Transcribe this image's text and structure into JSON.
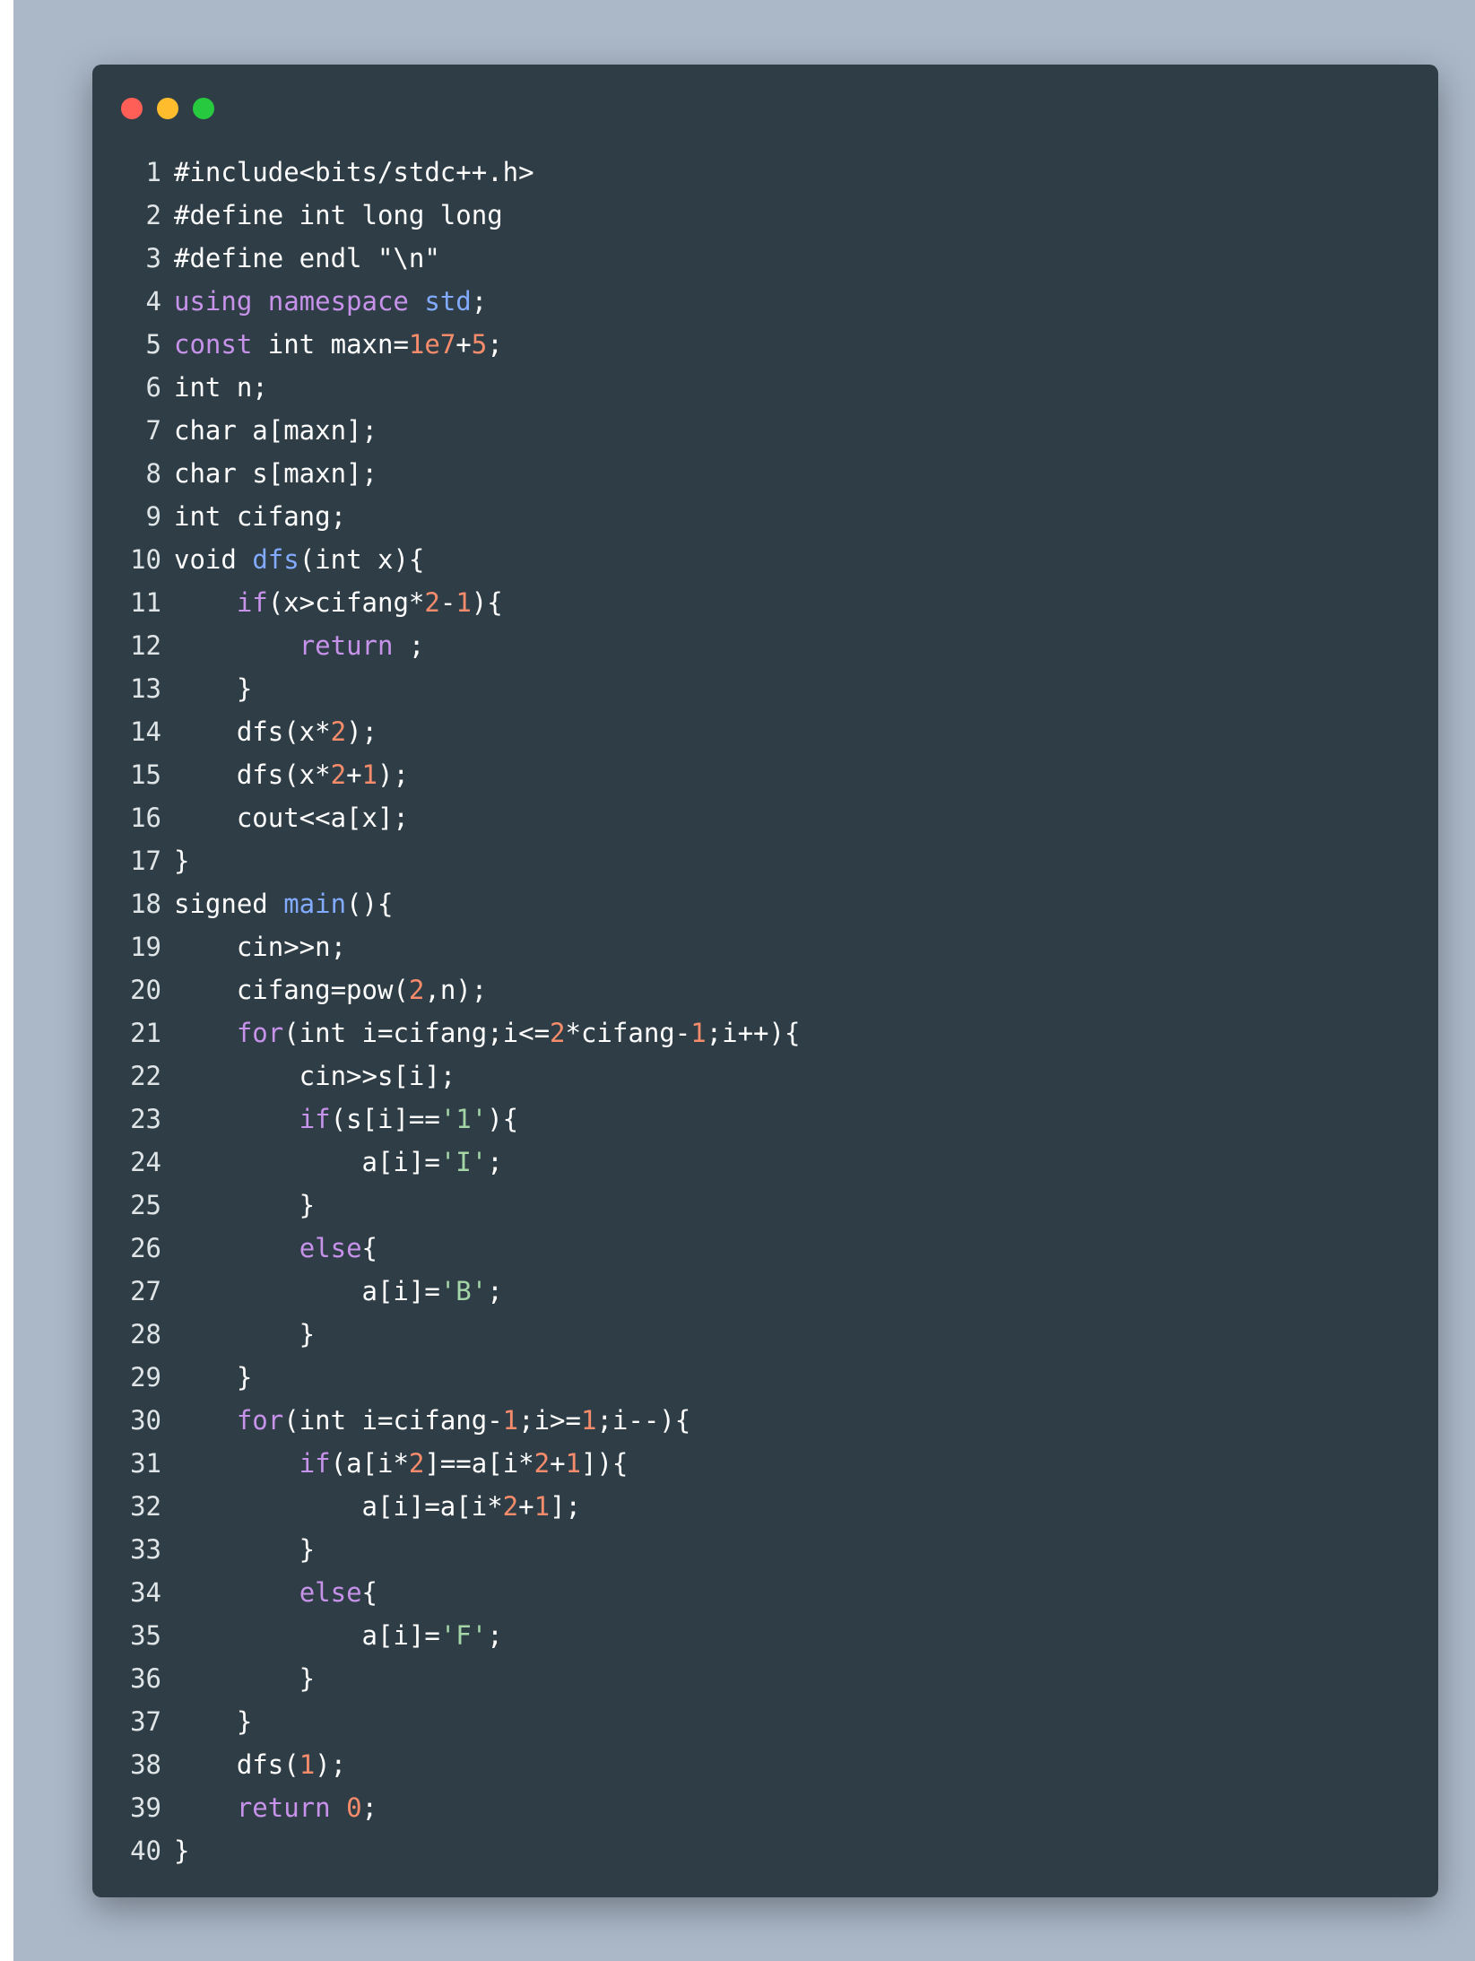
{
  "window": {
    "controls": [
      {
        "name": "close",
        "color": "#ff5f56"
      },
      {
        "name": "minimize",
        "color": "#ffbd2e"
      },
      {
        "name": "maximize",
        "color": "#27c93f"
      }
    ]
  },
  "token_colors": {
    "keyword": "#c792ea",
    "number": "#f78c6c",
    "function": "#82aaff",
    "string": "#a5d6a7",
    "plain": "#ffffff"
  },
  "lines": [
    [
      [
        "p",
        "#include<bits/stdc++.h>"
      ]
    ],
    [
      [
        "p",
        "#define int long long"
      ]
    ],
    [
      [
        "p",
        "#define endl \"\\n\""
      ]
    ],
    [
      [
        "k",
        "using namespace "
      ],
      [
        "f",
        "std"
      ],
      [
        "p",
        ";"
      ]
    ],
    [
      [
        "k",
        "const "
      ],
      [
        "p",
        "int maxn="
      ],
      [
        "n",
        "1e7"
      ],
      [
        "p",
        "+"
      ],
      [
        "n",
        "5"
      ],
      [
        "p",
        ";"
      ]
    ],
    [
      [
        "p",
        "int n;"
      ]
    ],
    [
      [
        "p",
        "char a[maxn];"
      ]
    ],
    [
      [
        "p",
        "char s[maxn];"
      ]
    ],
    [
      [
        "p",
        "int cifang;"
      ]
    ],
    [
      [
        "p",
        "void "
      ],
      [
        "f",
        "dfs"
      ],
      [
        "p",
        "(int x){"
      ]
    ],
    [
      [
        "p",
        "    "
      ],
      [
        "k",
        "if"
      ],
      [
        "p",
        "(x>cifang*"
      ],
      [
        "n",
        "2"
      ],
      [
        "p",
        "-"
      ],
      [
        "n",
        "1"
      ],
      [
        "p",
        "){"
      ]
    ],
    [
      [
        "p",
        "        "
      ],
      [
        "k",
        "return"
      ],
      [
        "p",
        " ;"
      ]
    ],
    [
      [
        "p",
        "    }"
      ]
    ],
    [
      [
        "p",
        "    dfs(x*"
      ],
      [
        "n",
        "2"
      ],
      [
        "p",
        ");"
      ]
    ],
    [
      [
        "p",
        "    dfs(x*"
      ],
      [
        "n",
        "2"
      ],
      [
        "p",
        "+"
      ],
      [
        "n",
        "1"
      ],
      [
        "p",
        ");"
      ]
    ],
    [
      [
        "p",
        "    cout<<a[x];"
      ]
    ],
    [
      [
        "p",
        "}"
      ]
    ],
    [
      [
        "p",
        "signed "
      ],
      [
        "f",
        "main"
      ],
      [
        "p",
        "(){"
      ]
    ],
    [
      [
        "p",
        "    cin>>n;"
      ]
    ],
    [
      [
        "p",
        "    cifang=pow("
      ],
      [
        "n",
        "2"
      ],
      [
        "p",
        ",n);"
      ]
    ],
    [
      [
        "p",
        "    "
      ],
      [
        "k",
        "for"
      ],
      [
        "p",
        "(int i=cifang;i<="
      ],
      [
        "n",
        "2"
      ],
      [
        "p",
        "*cifang-"
      ],
      [
        "n",
        "1"
      ],
      [
        "p",
        ";i++){"
      ]
    ],
    [
      [
        "p",
        "        cin>>s[i];"
      ]
    ],
    [
      [
        "p",
        "        "
      ],
      [
        "k",
        "if"
      ],
      [
        "p",
        "(s[i]=="
      ],
      [
        "s",
        "'1'"
      ],
      [
        "p",
        "){"
      ]
    ],
    [
      [
        "p",
        "            a[i]="
      ],
      [
        "s",
        "'I'"
      ],
      [
        "p",
        ";"
      ]
    ],
    [
      [
        "p",
        "        }"
      ]
    ],
    [
      [
        "p",
        "        "
      ],
      [
        "k",
        "else"
      ],
      [
        "p",
        "{"
      ]
    ],
    [
      [
        "p",
        "            a[i]="
      ],
      [
        "s",
        "'B'"
      ],
      [
        "p",
        ";"
      ]
    ],
    [
      [
        "p",
        "        }"
      ]
    ],
    [
      [
        "p",
        "    }"
      ]
    ],
    [
      [
        "p",
        "    "
      ],
      [
        "k",
        "for"
      ],
      [
        "p",
        "(int i=cifang-"
      ],
      [
        "n",
        "1"
      ],
      [
        "p",
        ";i>="
      ],
      [
        "n",
        "1"
      ],
      [
        "p",
        ";i--){"
      ]
    ],
    [
      [
        "p",
        "        "
      ],
      [
        "k",
        "if"
      ],
      [
        "p",
        "(a[i*"
      ],
      [
        "n",
        "2"
      ],
      [
        "p",
        "]==a[i*"
      ],
      [
        "n",
        "2"
      ],
      [
        "p",
        "+"
      ],
      [
        "n",
        "1"
      ],
      [
        "p",
        "]){"
      ]
    ],
    [
      [
        "p",
        "            a[i]=a[i*"
      ],
      [
        "n",
        "2"
      ],
      [
        "p",
        "+"
      ],
      [
        "n",
        "1"
      ],
      [
        "p",
        "];"
      ]
    ],
    [
      [
        "p",
        "        }"
      ]
    ],
    [
      [
        "p",
        "        "
      ],
      [
        "k",
        "else"
      ],
      [
        "p",
        "{"
      ]
    ],
    [
      [
        "p",
        "            a[i]="
      ],
      [
        "s",
        "'F'"
      ],
      [
        "p",
        ";"
      ]
    ],
    [
      [
        "p",
        "        }"
      ]
    ],
    [
      [
        "p",
        "    }"
      ]
    ],
    [
      [
        "p",
        "    dfs("
      ],
      [
        "n",
        "1"
      ],
      [
        "p",
        ");"
      ]
    ],
    [
      [
        "p",
        "    "
      ],
      [
        "k",
        "return "
      ],
      [
        "n",
        "0"
      ],
      [
        "p",
        ";"
      ]
    ],
    [
      [
        "p",
        "}"
      ]
    ]
  ]
}
